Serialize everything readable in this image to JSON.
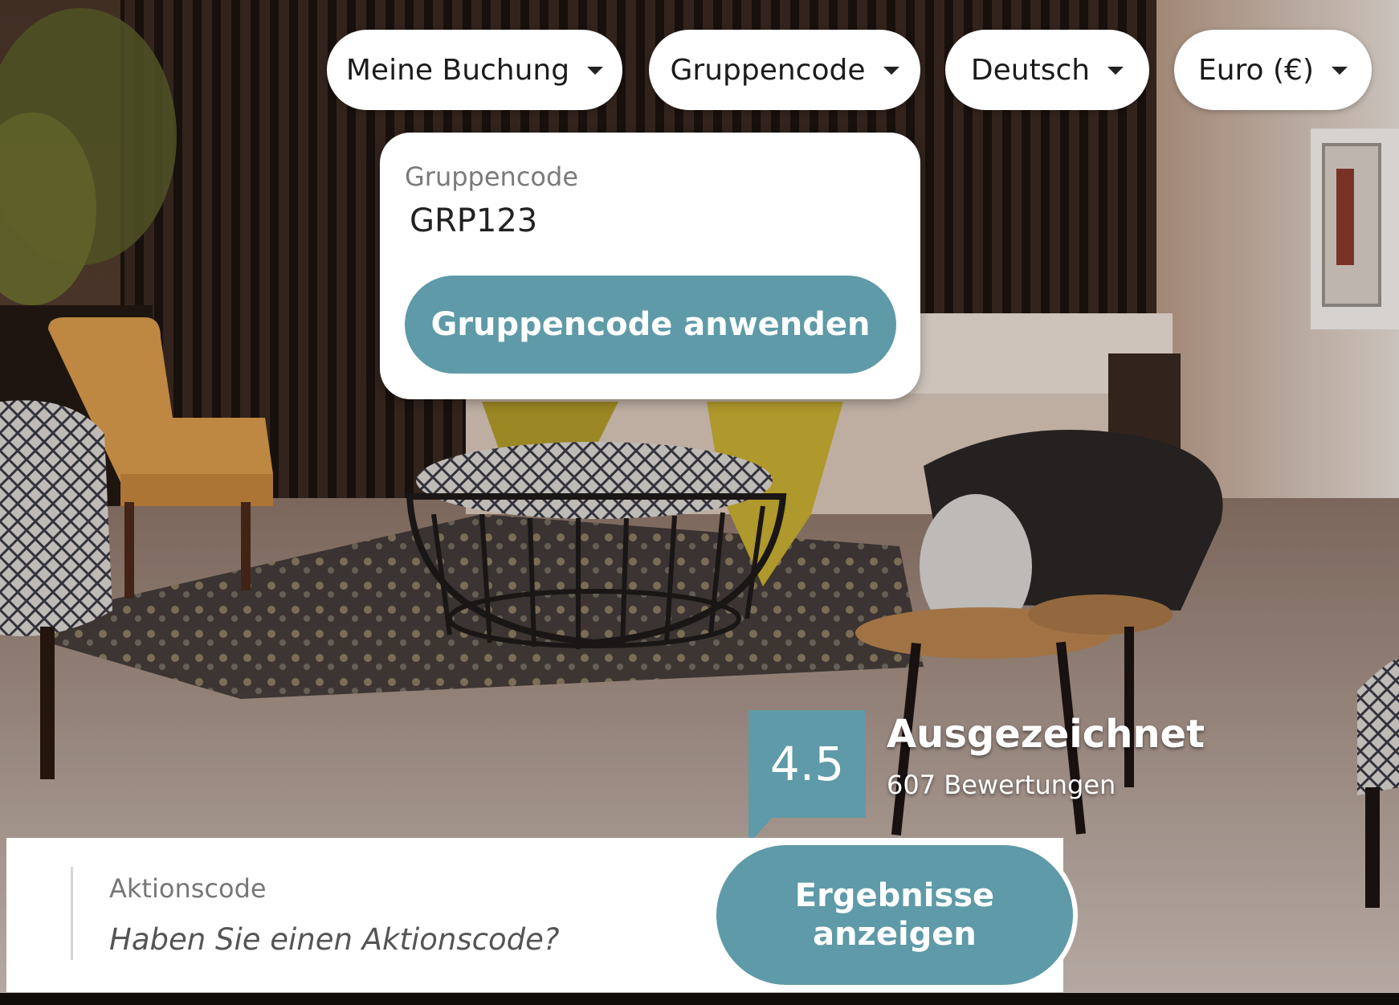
{
  "header": {
    "menus": [
      {
        "label": "Meine Buchung"
      },
      {
        "label": "Gruppencode"
      },
      {
        "label": "Deutsch"
      },
      {
        "label": "Euro (€)"
      }
    ]
  },
  "group_code": {
    "label": "Gruppencode",
    "value": "GRP123",
    "apply_label": "Gruppencode anwenden"
  },
  "rating": {
    "score": "4.5",
    "verdict": "Ausgezeichnet",
    "reviews": "607 Bewertungen"
  },
  "search_bar": {
    "promo_label": "Aktionscode",
    "promo_placeholder": "Haben Sie einen Aktionscode?",
    "results_label": "Ergebnisse anzeigen"
  },
  "colors": {
    "accent": "#5e9aa8",
    "surface": "#ffffff"
  }
}
